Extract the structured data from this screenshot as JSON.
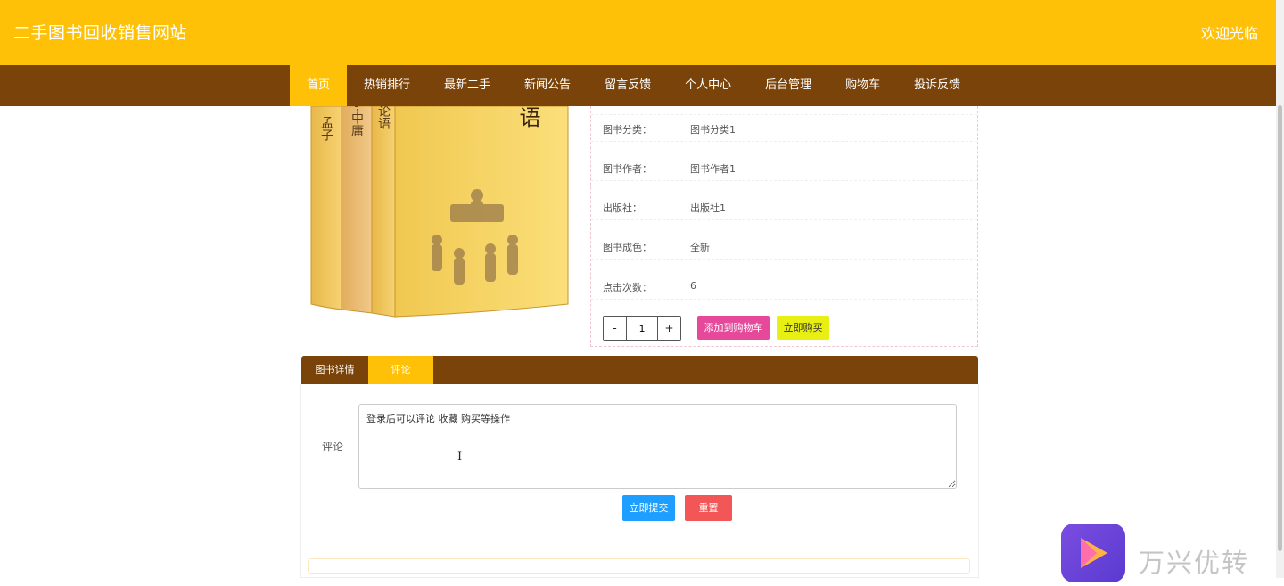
{
  "header": {
    "site_title": "二手图书回收销售网站",
    "welcome": "欢迎光临"
  },
  "nav": {
    "items": [
      {
        "label": "首页",
        "active": true
      },
      {
        "label": "热销排行"
      },
      {
        "label": "最新二手"
      },
      {
        "label": "新闻公告"
      },
      {
        "label": "留言反馈"
      },
      {
        "label": "个人中心"
      },
      {
        "label": "后台管理"
      },
      {
        "label": "购物车"
      },
      {
        "label": "投诉反馈"
      }
    ]
  },
  "book": {
    "cover_titles": [
      "孟子",
      "大学·中庸",
      "论语",
      "论语"
    ],
    "info": [
      {
        "label": "图书分类：",
        "value": "图书分类1"
      },
      {
        "label": "图书作者：",
        "value": "图书作者1"
      },
      {
        "label": "出版社：",
        "value": "出版社1"
      },
      {
        "label": "图书成色：",
        "value": "全新"
      },
      {
        "label": "点击次数：",
        "value": "6"
      }
    ],
    "quantity": {
      "minus": "-",
      "value": "1",
      "plus": "+"
    },
    "add_to_cart": "添加到购物车",
    "buy_now": "立即购买"
  },
  "tabs": [
    {
      "label": "图书详情"
    },
    {
      "label": "评论",
      "active": true
    }
  ],
  "comment_form": {
    "label": "评论",
    "textarea_value": "登录后可以评论 收藏 购买等操作",
    "submit": "立即提交",
    "reset": "重置"
  },
  "watermark": {
    "text": "万兴优转"
  },
  "colors": {
    "header": "#ffc107",
    "nav": "#7a430a",
    "add_cart": "#e7499a",
    "buy_now": "#e8ef12",
    "submit": "#1e9fff",
    "reset": "#f25656"
  }
}
